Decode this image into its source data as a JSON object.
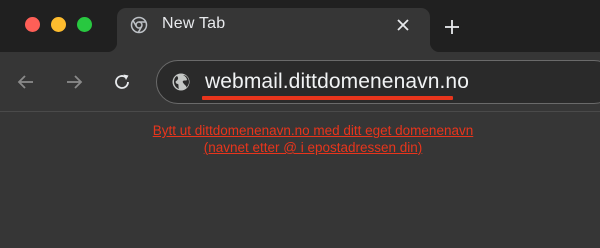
{
  "window": {
    "controls": [
      "close",
      "minimize",
      "zoom"
    ]
  },
  "tab": {
    "title": "New Tab",
    "favicon": "chrome-icon",
    "close_icon": "close-icon"
  },
  "new_tab_icon": "plus-icon",
  "toolbar": {
    "back_icon": "arrow-left-icon",
    "forward_icon": "arrow-right-icon",
    "reload_icon": "reload-icon",
    "site_icon": "globe-icon",
    "url": "webmail.dittdomenenavn.no"
  },
  "instructions": {
    "line1": "Bytt ut dittdomenenavn.no med ditt eget domenenavn",
    "line2": "(navnet etter @ i epostadressen din)"
  },
  "colors": {
    "annotation": "#e8351c",
    "tabstrip": "#202020",
    "toolbar": "#363636"
  }
}
